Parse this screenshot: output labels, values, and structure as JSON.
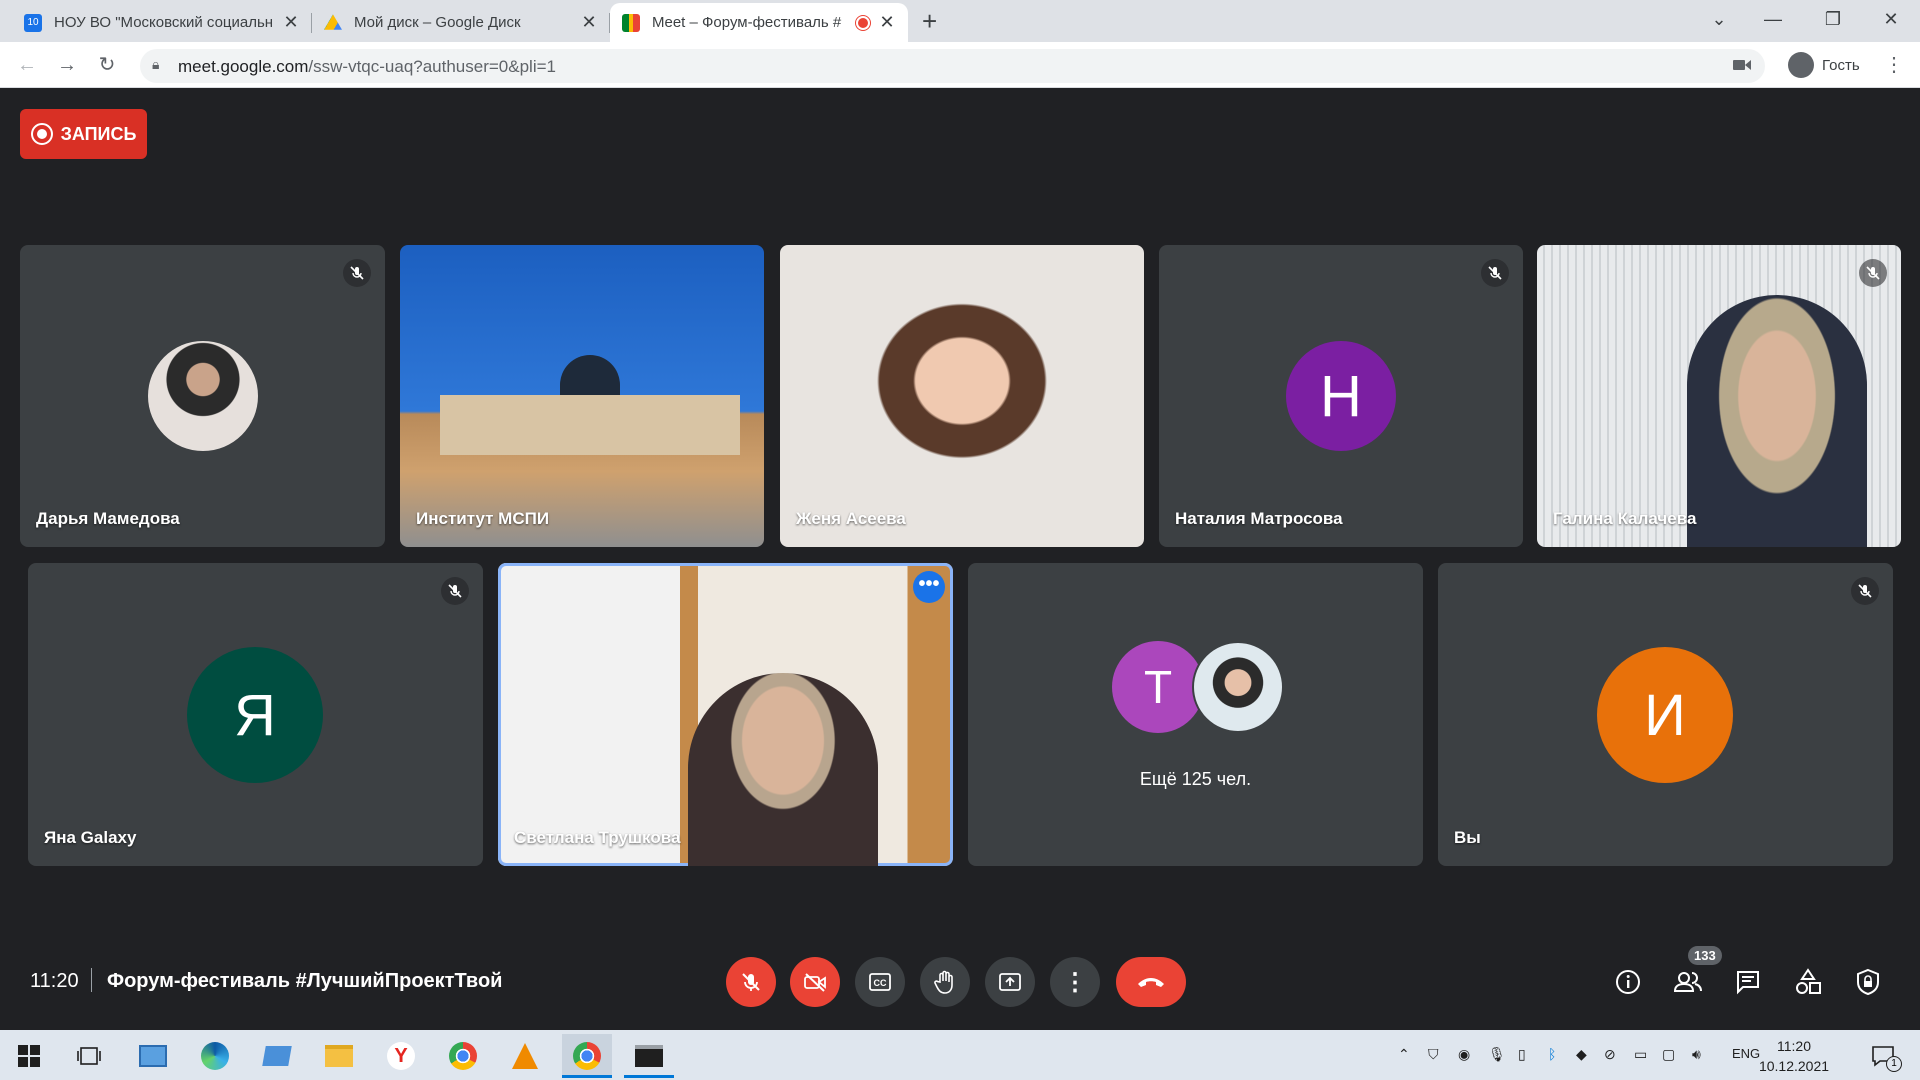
{
  "browser": {
    "tabs": [
      {
        "title": "НОУ ВО \"Московский социальн",
        "favicon_color": "#1a73e8"
      },
      {
        "title": "Мой диск – Google Диск",
        "favicon_color": "#fbbc04"
      },
      {
        "title": "Meet – Форум-фестиваль #",
        "favicon_color": "#00832d"
      }
    ],
    "new_tab": "+",
    "url_host": "meet.google.com",
    "url_path": "/ssw-vtqc-uaq?authuser=0&pli=1",
    "profile_label": "Гость"
  },
  "meet": {
    "record_label": "ЗАПИСЬ",
    "participants": [
      {
        "name": "Дарья Мамедова"
      },
      {
        "name": "Институт МСПИ"
      },
      {
        "name": "Женя Асеева"
      },
      {
        "name": "Наталия Матросова",
        "initial": "Н",
        "color": "#7b1fa2"
      },
      {
        "name": "Галина Калачева"
      },
      {
        "name": "Яна Galaxy",
        "initial": "Я",
        "color": "#004d40"
      },
      {
        "name": "Светлана Трушкова"
      },
      {
        "initial": "Т",
        "color": "#ab47bc",
        "more_label": "Ещё 125 чел."
      },
      {
        "name": "Вы",
        "initial": "И",
        "color": "#e8710a"
      }
    ],
    "clock": "11:20",
    "meeting_title": "Форум-фестиваль #ЛучшийПроектТвой",
    "participant_count": "133"
  },
  "taskbar": {
    "lang": "ENG",
    "time": "11:20",
    "date": "10.12.2021",
    "notif_count": "1"
  }
}
